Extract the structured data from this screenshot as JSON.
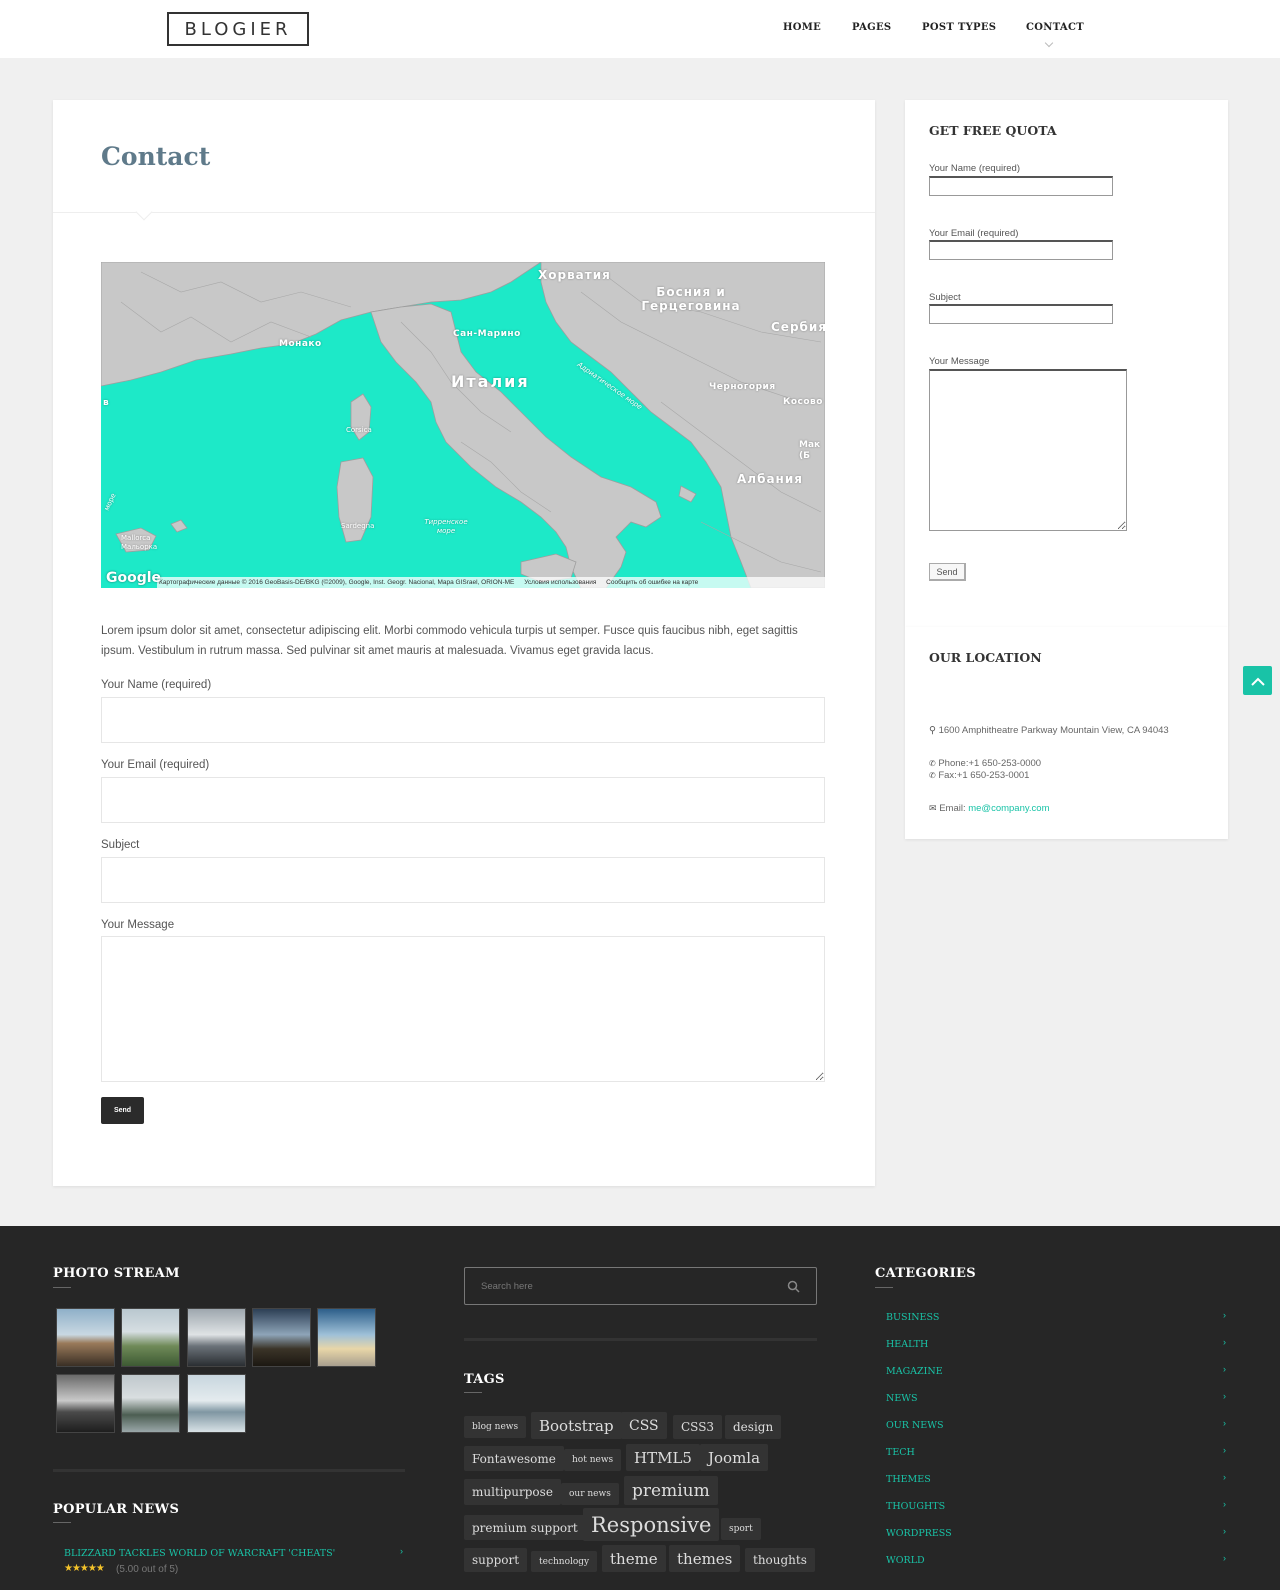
{
  "header": {
    "logo": "BLOGIER",
    "nav": [
      "HOME",
      "PAGES",
      "POST TYPES",
      "CONTACT"
    ]
  },
  "main": {
    "title": "Contact",
    "map": {
      "labels": [
        "Хорватия",
        "Босния и Герцеговина",
        "Сербия",
        "Сан-Марино",
        "Монако",
        "Италия",
        "Адриатическое море",
        "Черногория",
        "Косово",
        "Мак (Б",
        "Албания",
        "Corsica",
        "Sardegna",
        "Тирренское море",
        "Mallorca",
        "Мальорка",
        "море",
        "в"
      ],
      "google": "Google",
      "attribution": "Картографические данные © 2016 GeoBasis-DE/BKG (©2009), Google, Inst. Geogr. Nacional, Mapa GISrael, ORION-ME",
      "terms": "Условия использования",
      "report": "Сообщить об ошибке на карте"
    },
    "intro": "Lorem ipsum dolor sit amet, consectetur adipiscing elit. Morbi commodo vehicula turpis ut semper. Fusce quis faucibus nibh, eget sagittis ipsum. Vestibulum in rutrum massa. Sed pulvinar sit amet mauris at malesuada. Vivamus eget gravida lacus.",
    "form": {
      "name_label": "Your Name (required)",
      "email_label": "Your Email (required)",
      "subject_label": "Subject",
      "message_label": "Your Message",
      "send": "Send"
    }
  },
  "sidebar": {
    "quota": {
      "title": "GET FREE QUOTA",
      "name_label": "Your Name (required)",
      "email_label": "Your Email (required)",
      "subject_label": "Subject",
      "message_label": "Your Message",
      "send": "Send"
    },
    "location": {
      "title": "OUR LOCATION",
      "address": "1600 Amphitheatre Parkway Mountain View, CA 94043",
      "phone": "Phone:+1 650-253-0000",
      "fax": "Fax:+1 650-253-0001",
      "email_label": "Email:",
      "email": "me@company.com"
    }
  },
  "footer": {
    "photo_stream_title": "PHOTO STREAM",
    "popular_title": "POPULAR NEWS",
    "popular_item": "BLIZZARD TACKLES WORLD OF WARCRAFT 'CHEATS'",
    "rating": "(5.00 out of 5)",
    "rating_value": 5,
    "search_placeholder": "Search here",
    "tags_title": "TAGS",
    "tags": [
      "blog news",
      "Bootstrap",
      "CSS",
      "CSS3",
      "design",
      "Fontawesome",
      "hot news",
      "HTML5",
      "Joomla",
      "multipurpose",
      "our news",
      "premium",
      "premium support",
      "Responsive",
      "sport",
      "support",
      "technology",
      "theme",
      "themes",
      "thoughts"
    ],
    "categories_title": "CATEGORIES",
    "categories": [
      "BUSINESS",
      "HEALTH",
      "MAGAZINE",
      "NEWS",
      "OUR NEWS",
      "TECH",
      "THEMES",
      "THOUGHTS",
      "WORDPRESS",
      "WORLD"
    ]
  },
  "colors": {
    "accent": "#19c3a7",
    "map_water": "#1de9c8",
    "footer_bg": "#262626",
    "page_bg": "#f0f0f0"
  }
}
